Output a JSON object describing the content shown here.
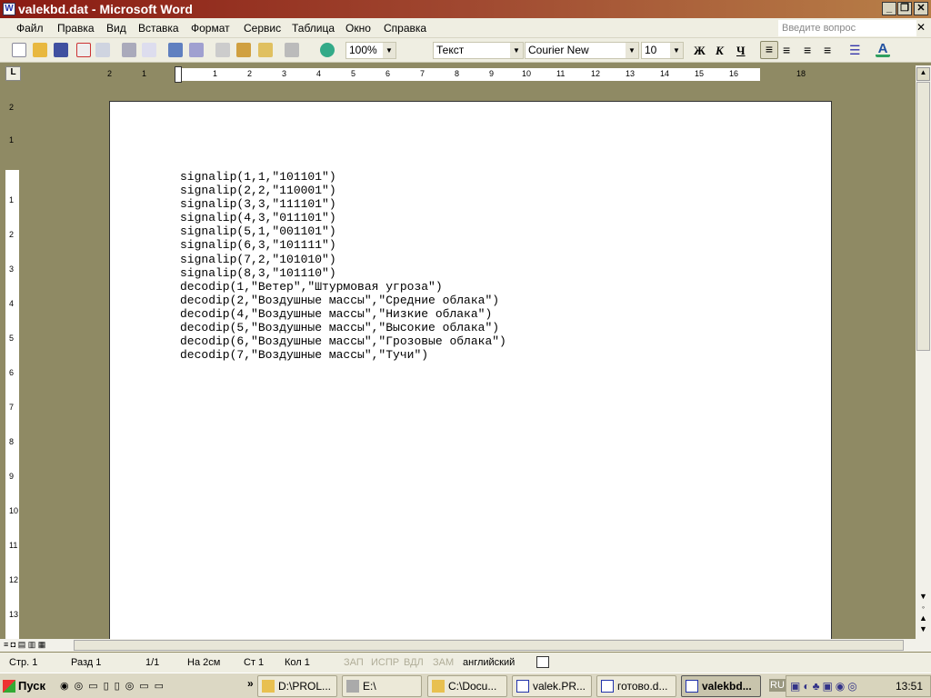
{
  "window": {
    "title": "valekbd.dat - Microsoft Word",
    "app_icon": "word-icon",
    "minimize": "_",
    "restore": "❐",
    "close": "✕"
  },
  "menu": {
    "items": [
      "Файл",
      "Правка",
      "Вид",
      "Вставка",
      "Формат",
      "Сервис",
      "Таблица",
      "Окно",
      "Справка"
    ],
    "help_placeholder": "Введите вопрос",
    "close_doc": "✕"
  },
  "toolbar": {
    "zoom": "100%",
    "style": "Текст",
    "font": "Courier New",
    "size": "10",
    "bold": "Ж",
    "italic": "К",
    "underline": "Ч",
    "font_color_icon": "A"
  },
  "ruler": {
    "h_labels": [
      "2",
      "1",
      "1",
      "2",
      "3",
      "4",
      "5",
      "6",
      "7",
      "8",
      "9",
      "10",
      "11",
      "12",
      "13",
      "14",
      "15",
      "16",
      "18"
    ],
    "v_labels": [
      "2",
      "1",
      "1",
      "2",
      "3",
      "4",
      "5",
      "6",
      "7",
      "8",
      "9",
      "10",
      "11",
      "12",
      "13"
    ]
  },
  "document": {
    "lines": [
      "signalip(1,1,\"101101\")",
      "signalip(2,2,\"110001\")",
      "signalip(3,3,\"111101\")",
      "signalip(4,3,\"011101\")",
      "signalip(5,1,\"001101\")",
      "signalip(6,3,\"101111\")",
      "signalip(7,2,\"101010\")",
      "signalip(8,3,\"101110\")",
      "decodip(1,\"Ветер\",\"Штурмовая угроза\")",
      "decodip(2,\"Воздушные массы\",\"Средние облака\")",
      "decodip(4,\"Воздушные массы\",\"Низкие облака\")",
      "decodip(5,\"Воздушные массы\",\"Высокие облака\")",
      "decodip(6,\"Воздушные массы\",\"Грозовые облака\")",
      "decodip(7,\"Воздушные массы\",\"Тучи\")"
    ]
  },
  "status": {
    "page": "Стр. 1",
    "section": "Разд 1",
    "pages": "1/1",
    "at": "На 2см",
    "line": "Ст 1",
    "col": "Кол 1",
    "rec": "ЗАП",
    "trk": "ИСПР",
    "ext": "ВДЛ",
    "ovr": "ЗАМ",
    "lang": "английский"
  },
  "taskbar": {
    "start": "Пуск",
    "tasks": [
      "D:\\PROL...",
      "E:\\",
      "C:\\Docu...",
      "valek.PR...",
      "готово.d...",
      "valekbd..."
    ],
    "lang": "RU",
    "clock": "13:51"
  }
}
